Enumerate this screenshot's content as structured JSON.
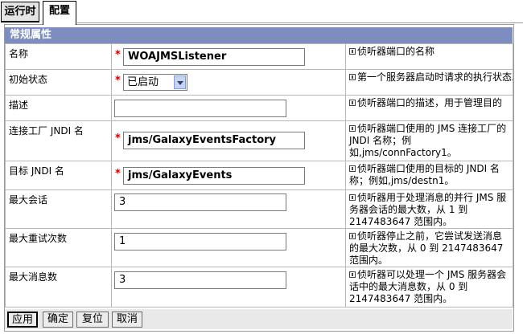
{
  "tabs": [
    "运行时",
    "配置"
  ],
  "section_title": "常规属性",
  "rows": [
    {
      "label": "名称",
      "required": true,
      "value": "WOAJMSListener",
      "help": "侦听器端口的名称"
    },
    {
      "label": "初始状态",
      "required": true,
      "select": "已启动",
      "help": "第一个服务器启动时请求的执行状态。"
    },
    {
      "label": "描述",
      "required": false,
      "value": "",
      "help": "侦听器端口的描述，用于管理目的"
    },
    {
      "label": "连接工厂 JNDI 名",
      "required": true,
      "value": "jms/GalaxyEventsFactory",
      "help": "侦听器端口使用的 JMS 连接工厂的 JNDI 名称；例如,jms/connFactory1。"
    },
    {
      "label": "目标 JNDI 名",
      "required": true,
      "value": "jms/GalaxyEvents",
      "help": "侦听器端口使用的目标的 JNDI 名称；例如,jms/destn1。"
    },
    {
      "label": "最大会话",
      "required": false,
      "value": "3",
      "help": "侦听器用于处理消息的并行 JMS 服务器会话的最大数，从 1 到 2147483647 范围内。"
    },
    {
      "label": "最大重试次数",
      "required": false,
      "value": "1",
      "help": "侦听器停止之前，它尝试发送消息的最大次数，从 0 到 2147483647 范围内。"
    },
    {
      "label": "最大消息数",
      "required": false,
      "value": "3",
      "help": "侦听器可以处理一个 JMS 服务器会话中的最大消息数，从 0 到 2147483647 范围内。"
    }
  ],
  "buttons": [
    "应用",
    "确定",
    "复位",
    "取消"
  ]
}
